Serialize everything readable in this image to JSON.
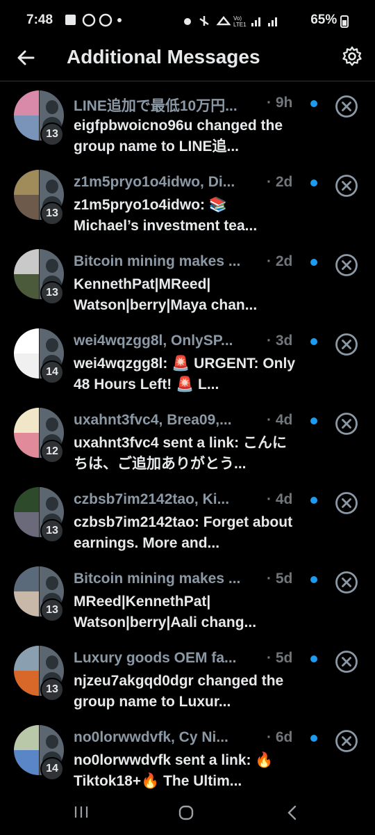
{
  "status_bar": {
    "time": "7:48",
    "left_icons": "▣ ◯ ◯ •",
    "right_icons": "🐾 🔇 Vo) LTE1 ıll ıll",
    "battery": "65%"
  },
  "header": {
    "title": "Additional Messages"
  },
  "conversations": [
    {
      "title": "LINE追加で最低10万円...",
      "time": "9h",
      "count": "13",
      "message": "eigfpbwoicno96u changed the group name to LINE追...",
      "avatar_colors": [
        "#d88aa8",
        "#7a93b8"
      ]
    },
    {
      "title": "z1m5pryo1o4idwo, Di...",
      "time": "2d",
      "count": "13",
      "message": "z1m5pryo1o4idwo: 📚 Michael’s investment tea...",
      "avatar_colors": [
        "#a08b5a",
        "#6e5a4a"
      ]
    },
    {
      "title": "Bitcoin mining makes ...",
      "time": "2d",
      "count": "13",
      "message": "KennethPat|MReed| Watson|berry|Maya chan...",
      "avatar_colors": [
        "#c9c9c9",
        "#4a5a3a"
      ]
    },
    {
      "title": "wei4wqzgg8l, OnlySP...",
      "time": "3d",
      "count": "14",
      "message": "wei4wqzgg8l: 🚨 URGENT: Only 48 Hours Left! 🚨 L...",
      "avatar_colors": [
        "#ffffff",
        "#f0f0f0"
      ]
    },
    {
      "title": "uxahnt3fvc4, Brea09,...",
      "time": "4d",
      "count": "12",
      "message": "uxahnt3fvc4 sent a link: こんにちは、ご追加ありがとう...",
      "avatar_colors": [
        "#f2e6c8",
        "#e08a9a"
      ]
    },
    {
      "title": "czbsb7im2142tao, Ki...",
      "time": "4d",
      "count": "13",
      "message": "czbsb7im2142tao: Forget about earnings. More and...",
      "avatar_colors": [
        "#2d4a2a",
        "#6a6a7a"
      ]
    },
    {
      "title": "Bitcoin mining makes ...",
      "time": "5d",
      "count": "13",
      "message": "MReed|KennethPat| Watson|berry|Aali chang...",
      "avatar_colors": [
        "#5a6a7a",
        "#c8b8a8"
      ]
    },
    {
      "title": "Luxury goods OEM fa...",
      "time": "5d",
      "count": "13",
      "message": "njzeu7akgqd0dgr changed the group name to Luxur...",
      "avatar_colors": [
        "#8aa0b0",
        "#d8682a"
      ]
    },
    {
      "title": "no0lorwwdvfk, Cy Ni...",
      "time": "6d",
      "count": "14",
      "message": "no0lorwwdvfk sent a link: 🔥Tiktok18+🔥 The Ultim...",
      "avatar_colors": [
        "#b8c8a8",
        "#5a86c8"
      ]
    }
  ],
  "colors": {
    "accent": "#1d9bf0",
    "background": "#000000",
    "muted": "#71767b"
  }
}
